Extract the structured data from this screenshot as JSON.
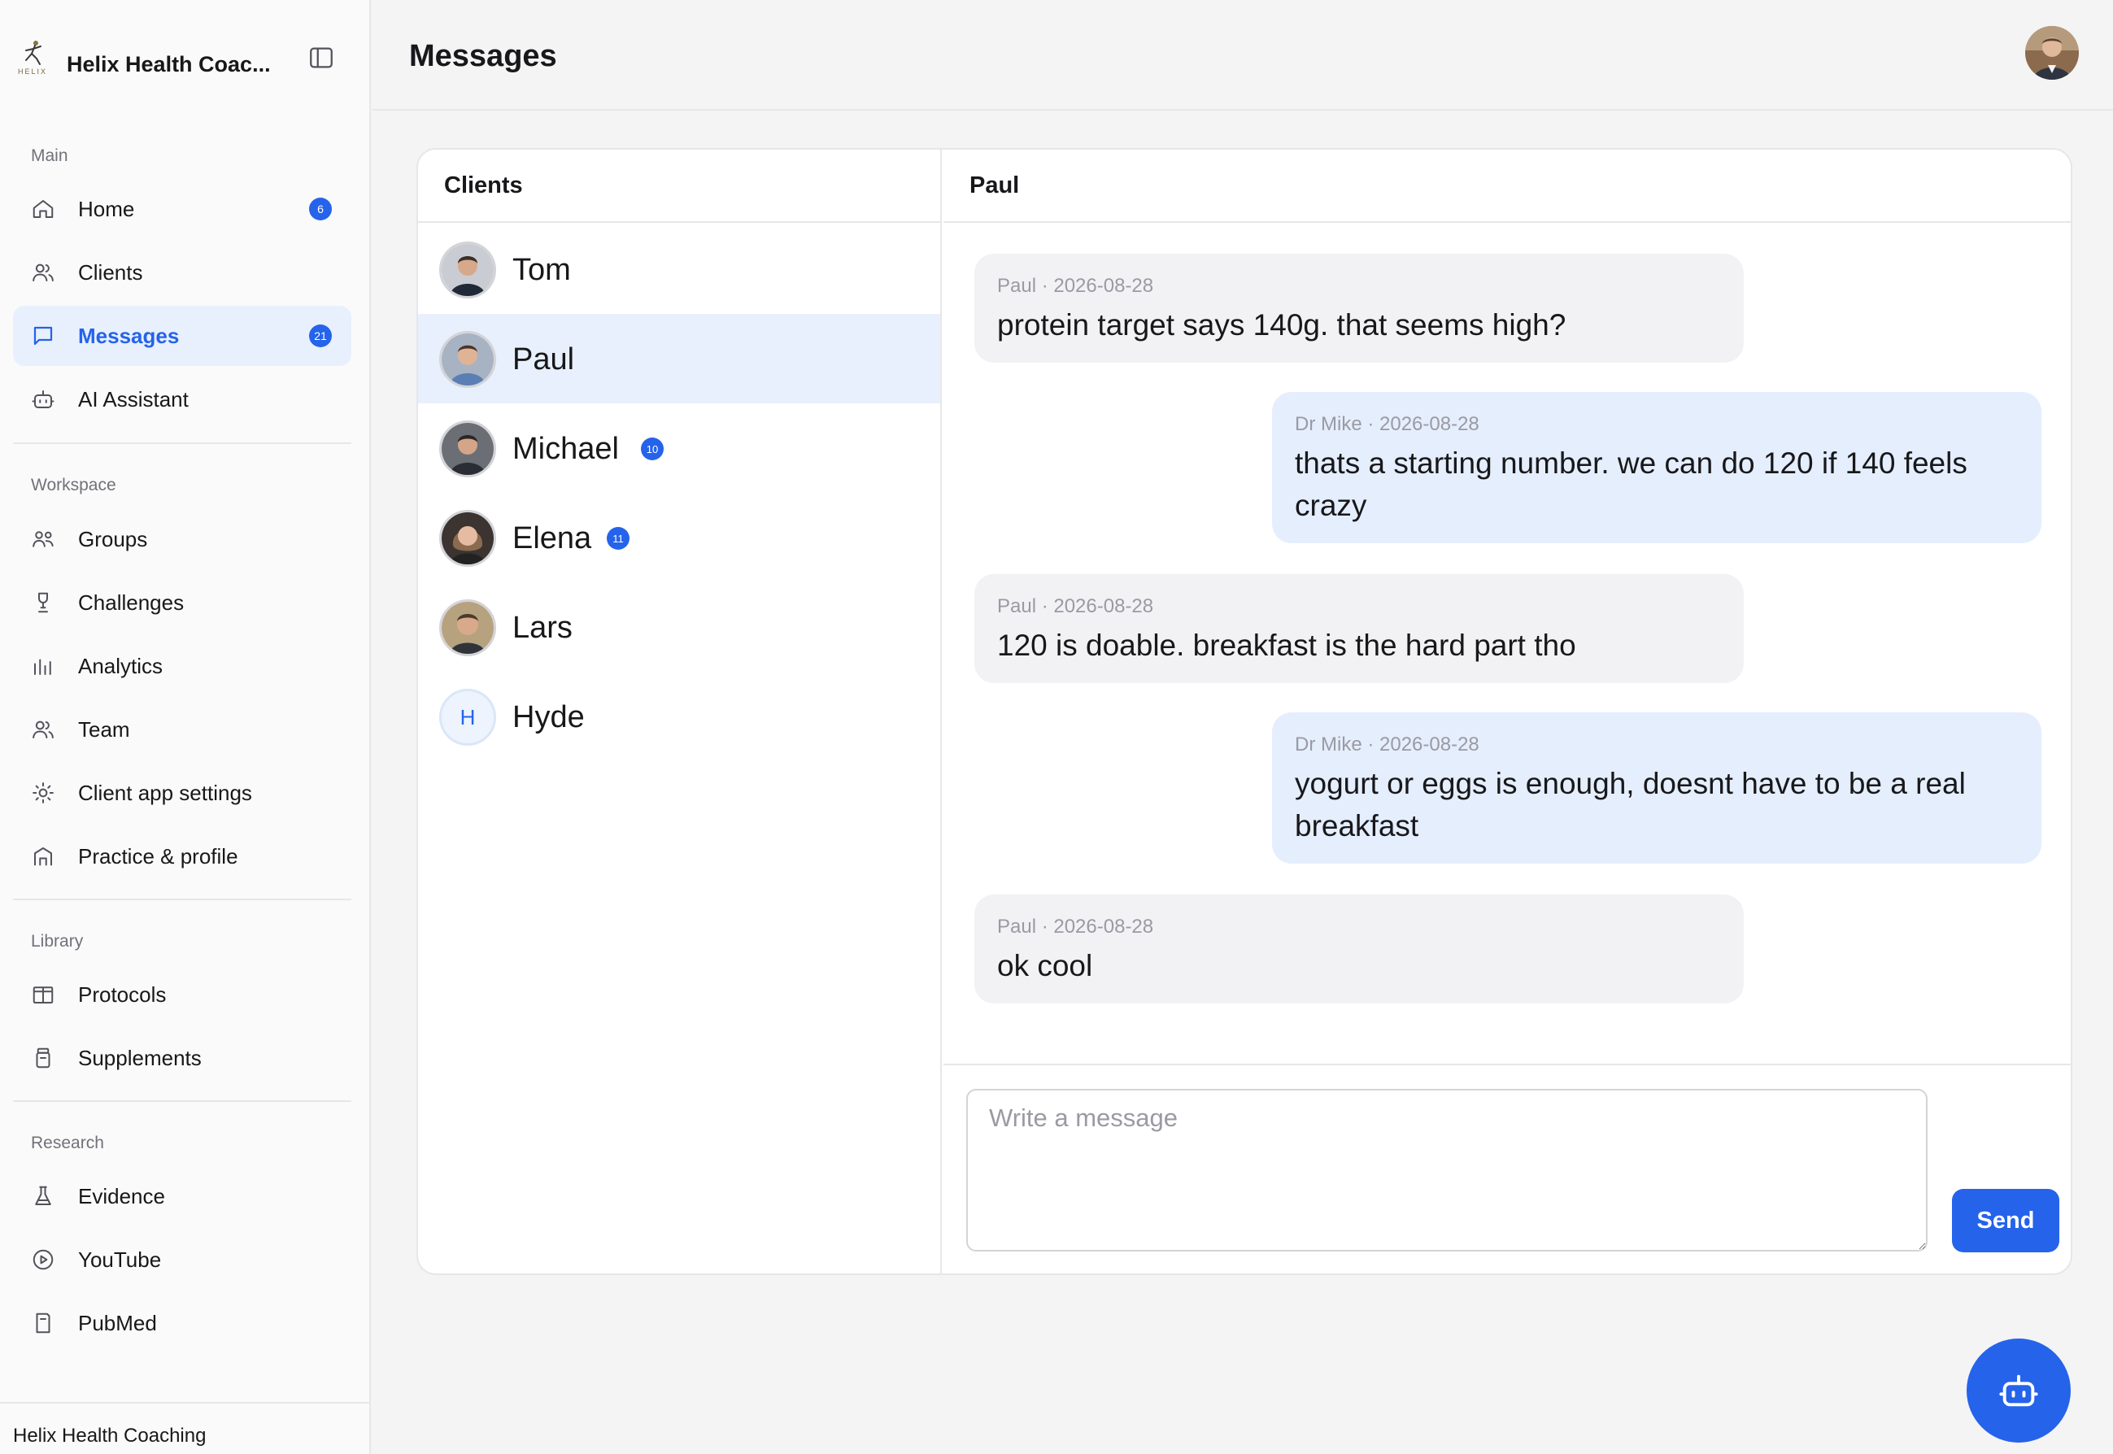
{
  "app": {
    "name": "Helix Health Coac...",
    "logo_text": "HELIX",
    "footer": "Helix Health Coaching",
    "accent_color": "#2563eb"
  },
  "sidebar": {
    "sections": {
      "main": "Main",
      "workspace": "Workspace",
      "library": "Library",
      "research": "Research"
    },
    "items": {
      "home": {
        "label": "Home",
        "badge": "6",
        "icon": "home-icon"
      },
      "clients": {
        "label": "Clients",
        "icon": "users-icon"
      },
      "messages": {
        "label": "Messages",
        "badge": "21",
        "icon": "message-square-icon"
      },
      "ai_assistant": {
        "label": "AI Assistant",
        "icon": "bot-icon"
      },
      "groups": {
        "label": "Groups",
        "icon": "groups-icon"
      },
      "challenges": {
        "label": "Challenges",
        "icon": "trophy-icon"
      },
      "analytics": {
        "label": "Analytics",
        "icon": "bar-chart-icon"
      },
      "team": {
        "label": "Team",
        "icon": "team-icon"
      },
      "client_app_settings": {
        "label": "Client app settings",
        "icon": "sun-settings-icon"
      },
      "practice_profile": {
        "label": "Practice & profile",
        "icon": "building-icon"
      },
      "protocols": {
        "label": "Protocols",
        "icon": "book-open-icon"
      },
      "supplements": {
        "label": "Supplements",
        "icon": "pill-bottle-icon"
      },
      "evidence": {
        "label": "Evidence",
        "icon": "flask-icon"
      },
      "youtube": {
        "label": "YouTube",
        "icon": "play-circle-icon"
      },
      "pubmed": {
        "label": "PubMed",
        "icon": "document-icon"
      }
    }
  },
  "header": {
    "title": "Messages"
  },
  "clients_panel": {
    "title": "Clients",
    "clients": [
      {
        "name": "Tom"
      },
      {
        "name": "Paul",
        "selected": true
      },
      {
        "name": "Michael",
        "badge": "10"
      },
      {
        "name": "Elena",
        "badge": "11"
      },
      {
        "name": "Lars"
      },
      {
        "name": "Hyde",
        "initial": "H"
      }
    ]
  },
  "chat": {
    "title": "Paul",
    "messages": [
      {
        "meta": "Paul · 2026-08-28",
        "text": "protein target says 140g. that seems high?",
        "direction": "in"
      },
      {
        "meta": "Dr Mike · 2026-08-28",
        "text": "thats a starting number. we can do 120 if 140 feels crazy",
        "direction": "out"
      },
      {
        "meta": "Paul · 2026-08-28",
        "text": "120 is doable. breakfast is the hard part tho",
        "direction": "in"
      },
      {
        "meta": "Dr Mike · 2026-08-28",
        "text": "yogurt or eggs is enough, doesnt have to be a real breakfast",
        "direction": "out"
      },
      {
        "meta": "Paul · 2026-08-28",
        "text": "ok cool",
        "direction": "in"
      }
    ],
    "composer": {
      "placeholder": "Write a message",
      "value": ""
    },
    "send_label": "Send"
  }
}
